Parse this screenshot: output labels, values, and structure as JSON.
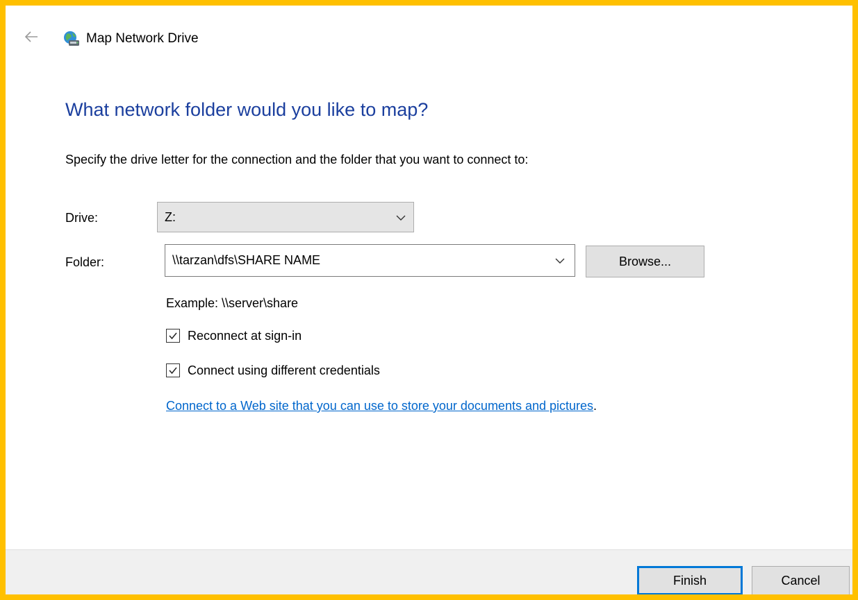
{
  "window": {
    "title": "Map Network Drive",
    "back_icon": "back-arrow-icon",
    "app_icon": "network-drive-icon"
  },
  "wizard": {
    "heading": "What network folder would you like to map?",
    "instructions": "Specify the drive letter for the connection and the folder that you want to connect to:"
  },
  "drive": {
    "label": "Drive:",
    "value": "Z:"
  },
  "folder": {
    "label": "Folder:",
    "value": "\\\\tarzan\\dfs\\SHARE NAME",
    "browse_label": "Browse...",
    "example": "Example: \\\\server\\share"
  },
  "options": {
    "reconnect": {
      "label": "Reconnect at sign-in",
      "checked": true
    },
    "different_credentials": {
      "label": "Connect using different credentials",
      "checked": true
    }
  },
  "web_link": {
    "text": "Connect to a Web site that you can use to store your documents and pictures",
    "suffix": "."
  },
  "footer": {
    "finish_label": "Finish",
    "cancel_label": "Cancel"
  },
  "colors": {
    "frame_border": "#ffc000",
    "heading": "#1b3f9e",
    "link": "#0066cc",
    "default_button_border": "#0078d7",
    "footer_background": "#f0f0f0"
  }
}
